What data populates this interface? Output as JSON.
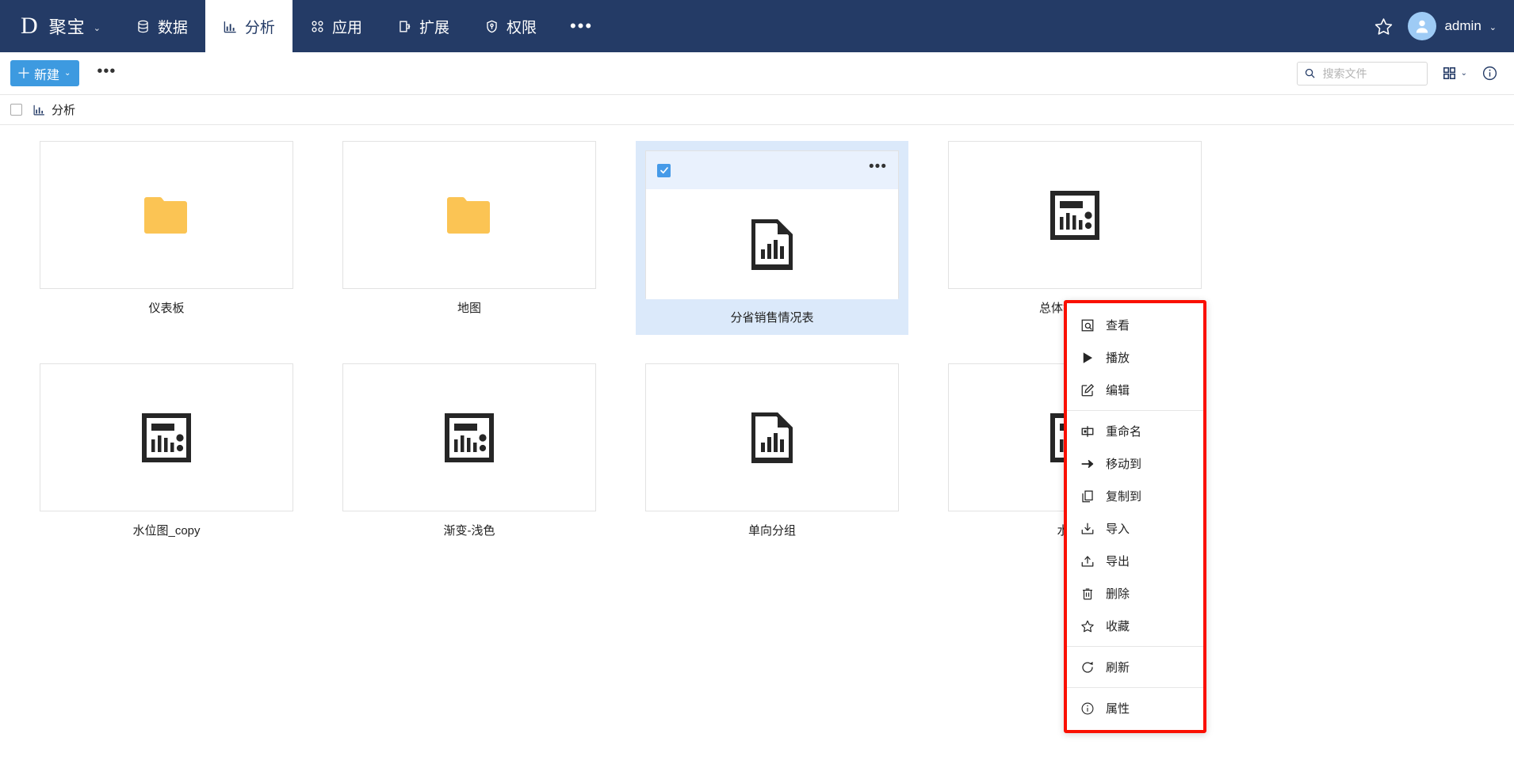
{
  "app": {
    "logo_letter": "D",
    "brand_name": "聚宝",
    "brand_caret": "⌄"
  },
  "nav": {
    "tabs": [
      {
        "label": "数据",
        "icon": "database-icon",
        "active": false
      },
      {
        "label": "分析",
        "icon": "bar-chart-icon",
        "active": true
      },
      {
        "label": "应用",
        "icon": "apps-grid-icon",
        "active": false
      },
      {
        "label": "扩展",
        "icon": "extension-icon",
        "active": false
      },
      {
        "label": "权限",
        "icon": "shield-key-icon",
        "active": false
      }
    ],
    "more_label": "•••",
    "star_icon": "star-outline-icon",
    "user": {
      "name": "admin",
      "avatar_icon": "user-avatar-icon",
      "caret": "⌄"
    }
  },
  "toolbar": {
    "new_button": {
      "plus": "＋",
      "label": "新建",
      "caret": "⌄"
    },
    "more_label": "•••",
    "search": {
      "placeholder": "搜索文件",
      "value": "",
      "icon": "search-icon"
    },
    "view_toggle": {
      "icon": "grid-view-icon",
      "caret": "⌄"
    },
    "info": {
      "icon": "info-circle-icon"
    }
  },
  "breadcrumb": {
    "checkbox_checked": false,
    "items": [
      {
        "label": "分析",
        "icon": "bar-chart-icon"
      }
    ]
  },
  "grid": {
    "rows": [
      [
        {
          "label": "仪表板",
          "icon": "folder-icon",
          "selected": false
        },
        {
          "label": "地图",
          "icon": "folder-icon",
          "selected": false
        },
        {
          "label": "分省销售情况表",
          "icon": "document-chart-icon",
          "selected": true
        },
        {
          "label": "总体销售情况",
          "icon": "dashboard-icon",
          "selected": false
        }
      ],
      [
        {
          "label": "水位图_copy",
          "icon": "dashboard-icon",
          "selected": false
        },
        {
          "label": "渐变-浅色",
          "icon": "dashboard-icon",
          "selected": false
        },
        {
          "label": "单向分组",
          "icon": "document-chart-icon",
          "selected": false
        },
        {
          "label": "水位图",
          "icon": "dashboard-icon",
          "selected": false
        }
      ]
    ]
  },
  "context_menu": {
    "highlight_color": "#fa0f00",
    "groups": [
      [
        {
          "label": "查看",
          "icon": "preview-icon"
        },
        {
          "label": "播放",
          "icon": "play-icon"
        },
        {
          "label": "编辑",
          "icon": "edit-pencil-icon"
        }
      ],
      [
        {
          "label": "重命名",
          "icon": "rename-icon"
        },
        {
          "label": "移动到",
          "icon": "move-arrow-icon"
        },
        {
          "label": "复制到",
          "icon": "copy-icon"
        },
        {
          "label": "导入",
          "icon": "import-icon"
        },
        {
          "label": "导出",
          "icon": "export-icon"
        },
        {
          "label": "删除",
          "icon": "trash-icon"
        },
        {
          "label": "收藏",
          "icon": "star-outline-icon"
        }
      ],
      [
        {
          "label": "刷新",
          "icon": "refresh-icon"
        }
      ],
      [
        {
          "label": "属性",
          "icon": "info-circle-icon"
        }
      ]
    ]
  }
}
